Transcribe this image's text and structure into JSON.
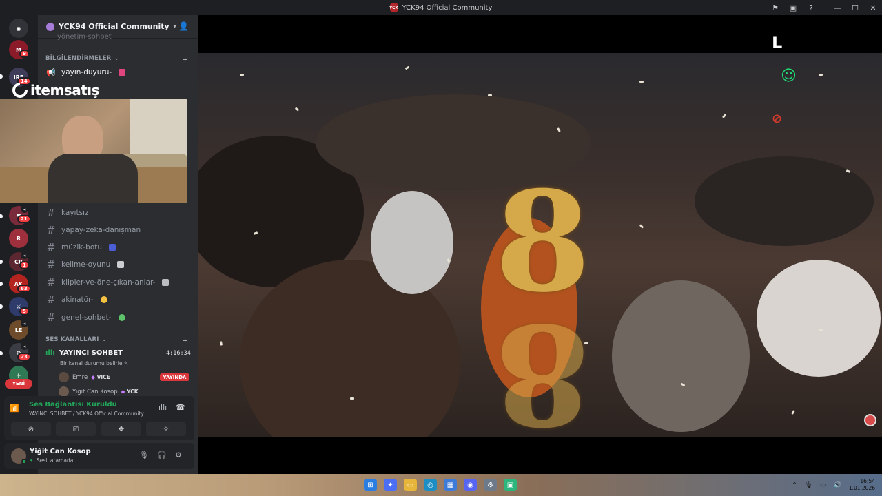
{
  "window": {
    "title": "YCK94 Official Community",
    "app_badge": "YCK"
  },
  "server": {
    "name": "YCK94 Official Community",
    "faded_channel": "yönetim-sohbet"
  },
  "categories": {
    "notifications": "BİLGİLENDİRMELER",
    "voice": "SES KANALLARI"
  },
  "announcement_channel": "yayın-duyuru-",
  "text_channels": [
    "kayıtsız",
    "yapay-zeka-danışman",
    "müzik-botu",
    "kelime-oyunu",
    "klipler-ve-öne-çıkan-anlar-",
    "akinatör-",
    "genel-sohbet-"
  ],
  "rail_badges": [
    "9",
    "14",
    "21",
    "1",
    "63",
    "5",
    "23"
  ],
  "rail_new_label": "YENİ",
  "overlay_logo": "itemsatış",
  "voice": {
    "channel": "YAYINCI SOHBET",
    "duration": "4:16:34",
    "status_prompt": "Bir kanal durumu belirle",
    "users": [
      {
        "name": "Emre",
        "tag": "VICE"
      },
      {
        "name": "Yiğit Can Kosop",
        "tag": "YCK"
      }
    ],
    "live_label": "YAYINDA"
  },
  "connection": {
    "title": "Ses Bağlantısı Kuruldu",
    "subtitle": "YAYINCI SOHBET / YCK94 Official Community"
  },
  "user": {
    "name": "Yiğit Can Kosop",
    "status": "Sesli aramada"
  },
  "stream": {
    "big_number": "8",
    "corner_mark": "L"
  },
  "taskbar": {
    "time": "16:54",
    "date": "1.01.2026"
  },
  "colors": {
    "accent_green": "#23a559",
    "live_red": "#da373c",
    "sidebar_bg": "#2b2d31"
  }
}
